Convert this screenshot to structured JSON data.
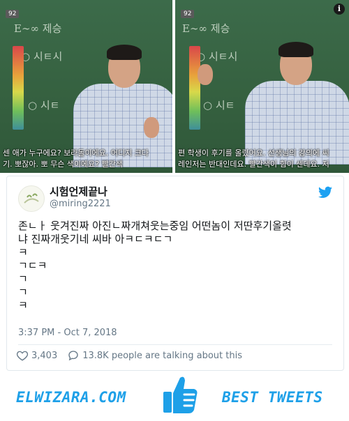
{
  "media": {
    "left": {
      "tag": "92",
      "chalk_top": "E∼∞ 제승",
      "chalk_mid": "○ 시ㅌ시",
      "chalk_low": "○ 시ㅌ",
      "subtitle_line1": "센 애가 누구에요? 보라돌이에요. 어디지 크다",
      "subtitle_line2": "기. 뽀잖아. 뽀 무슨 색이에요? 빨간색"
    },
    "right": {
      "tag": "92",
      "chalk_top": "E∼∞ 제승",
      "chalk_mid": "○ 시ㅌ시",
      "chalk_low": "○ 시ㅌ",
      "subtitle_line1": "편 학생이 후기를 올렸어요. 선생님의 강의에 씨",
      "subtitle_line2": "레인저는 반대인데요. 빨간색이 힘이 센데요. 저"
    },
    "info_icon": "i"
  },
  "tweet": {
    "display_name": "시험언제끝나",
    "handle": "@miring2221",
    "text": "존ㄴㅏ 웃겨진짜 아진ㄴ짜개쳐웃는중임 어떤놈이 저딴후기올렷\n냐 진짜개웃기네 씨바 아ㅋㄷㅋㄷㄱ\nㅋ\nㄱㄷㅋ\nㄱ\nㄱ\nㅋ",
    "timestamp": "3:37 PM - Oct 7, 2018",
    "likes": "3,403",
    "replies_text": "13.8K people are talking about this",
    "brand_color": "#1da1f2"
  },
  "footer": {
    "brand": "ELWIZARA.COM",
    "best": "BEST TWEETS",
    "accent": "#1ea0e8"
  }
}
